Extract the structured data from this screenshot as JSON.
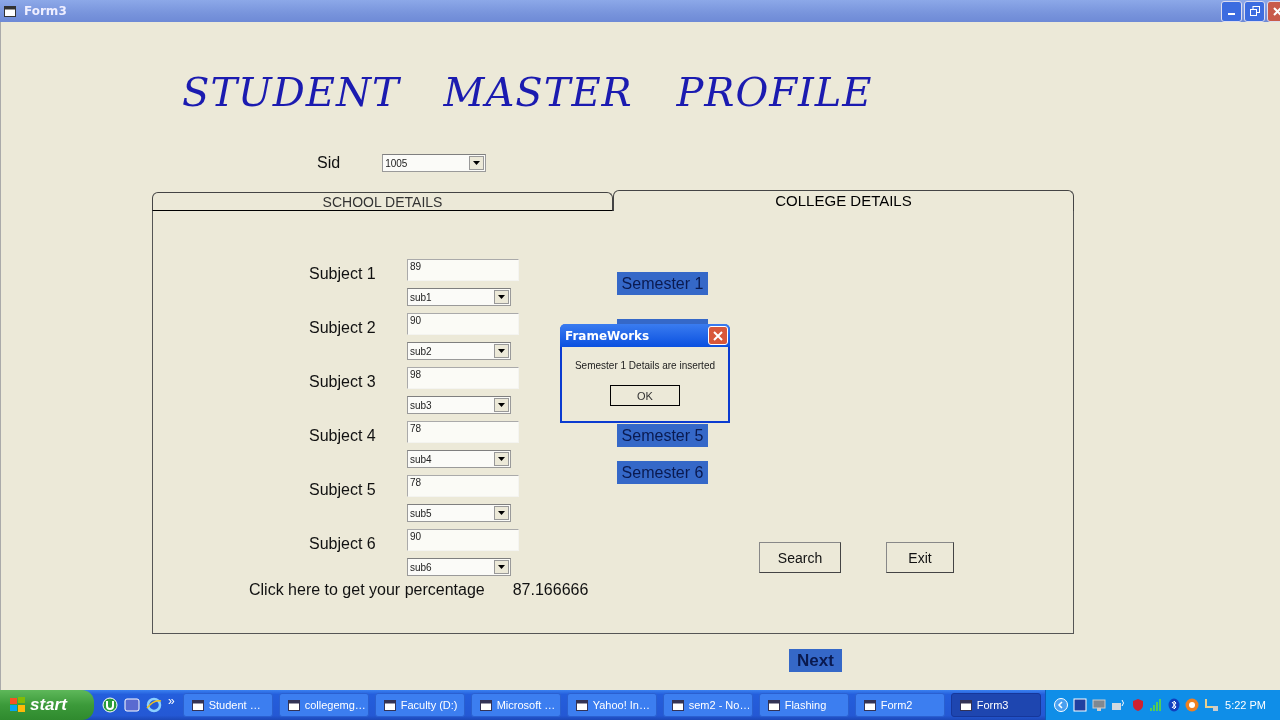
{
  "window": {
    "title": "Form3"
  },
  "heading": "STUDENT MASTER PROFILE",
  "sid": {
    "label": "Sid",
    "value": "1005"
  },
  "tabs": [
    {
      "label": "SCHOOL DETAILS",
      "selected": false
    },
    {
      "label": "COLLEGE DETAILS",
      "selected": true
    }
  ],
  "subjects": [
    {
      "label": "Subject 1",
      "mark": "89",
      "subject": "sub1"
    },
    {
      "label": "Subject 2",
      "mark": "90",
      "subject": "sub2"
    },
    {
      "label": "Subject 3",
      "mark": "98",
      "subject": "sub3"
    },
    {
      "label": "Subject 4",
      "mark": "78",
      "subject": "sub4"
    },
    {
      "label": "Subject 5",
      "mark": "78",
      "subject": "sub5"
    },
    {
      "label": "Subject 6",
      "mark": "90",
      "subject": "sub6"
    }
  ],
  "percentage": {
    "label": "Click here to get your percentage",
    "value": "87.166666"
  },
  "semesters": [
    {
      "kind": "button",
      "label": "Semester 1"
    },
    {
      "kind": "covered"
    },
    {
      "kind": "button",
      "label": "Semester 5"
    },
    {
      "kind": "button",
      "label": "Semester 6"
    }
  ],
  "buttons": [
    "Search",
    "Exit"
  ],
  "next_button": "Next",
  "dialog": {
    "title": "FrameWorks",
    "message": "Semester 1 Details are inserted",
    "button": "OK"
  },
  "taskbar": {
    "start": "start",
    "more": "»",
    "clock": "5:22 PM",
    "tasks": [
      {
        "label": "Student …",
        "selected": false
      },
      {
        "label": "collegemg…",
        "selected": false
      },
      {
        "label": "Faculty (D:)",
        "selected": false
      },
      {
        "label": "Microsoft …",
        "selected": false
      },
      {
        "label": "Yahoo! In…",
        "selected": false
      },
      {
        "label": "sem2 - No…",
        "selected": false
      },
      {
        "label": "Flashing",
        "selected": false
      },
      {
        "label": "Form2",
        "selected": false
      },
      {
        "label": "Form3",
        "selected": true
      }
    ]
  }
}
